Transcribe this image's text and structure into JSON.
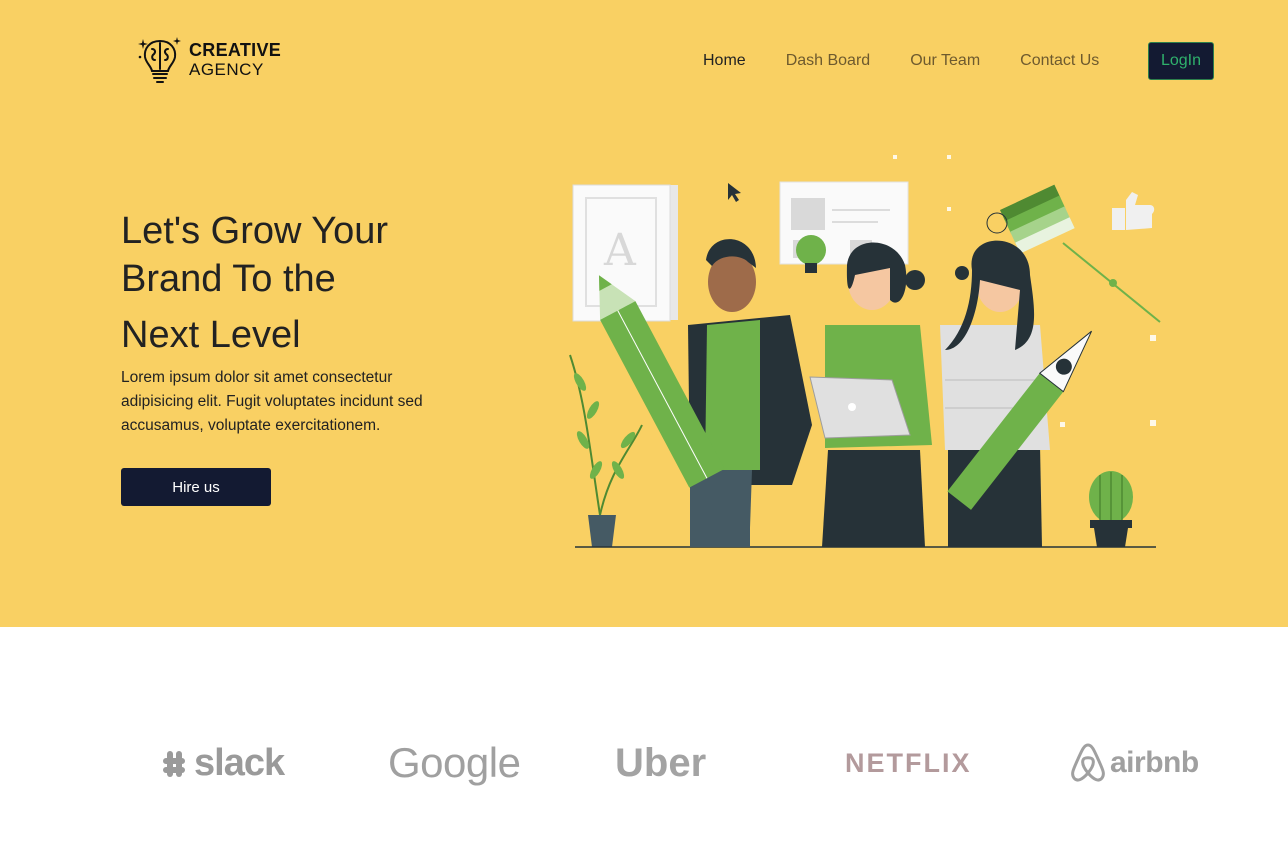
{
  "brand": {
    "line1": "CREATIVE",
    "line2": "AGENCY",
    "icon": "brain-lightbulb-icon"
  },
  "nav": {
    "items": [
      {
        "label": "Home",
        "active": true
      },
      {
        "label": "Dash Board",
        "active": false
      },
      {
        "label": "Our Team",
        "active": false
      },
      {
        "label": "Contact Us",
        "active": false
      }
    ],
    "login_label": "LogIn"
  },
  "hero": {
    "title_lines": [
      "Let's Grow Your",
      "Brand To the",
      "Next Level"
    ],
    "description": "Lorem ipsum dolor sit amet consectetur adipisicing elit. Fugit voluptates incidunt sed accusamus, voluptate exercitationem.",
    "cta_label": "Hire us",
    "illustration": "team-with-pencil-illustration"
  },
  "clients": [
    {
      "name": "slack",
      "icon": "slack-logo"
    },
    {
      "name": "Google",
      "icon": "google-logo"
    },
    {
      "name": "Uber",
      "icon": "uber-logo"
    },
    {
      "name": "NETFLIX",
      "icon": "netflix-logo"
    },
    {
      "name": "airbnb",
      "icon": "airbnb-logo"
    }
  ],
  "colors": {
    "hero_bg": "#f9d063",
    "dark_button": "#131a32",
    "login_text": "#2fb16c",
    "accent_green": "#6fb24a"
  }
}
